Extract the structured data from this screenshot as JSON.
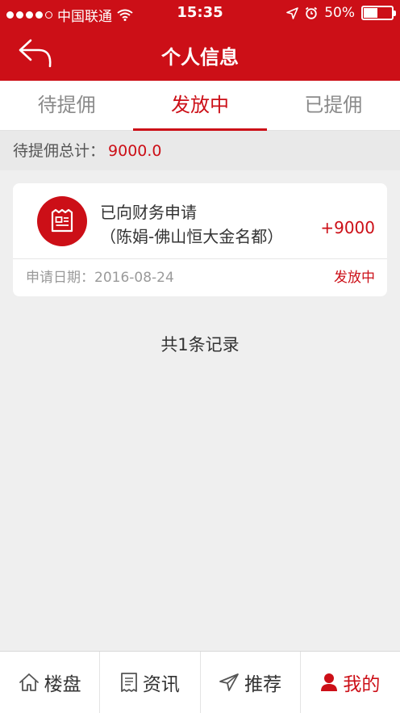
{
  "status_bar": {
    "carrier": "中国联通",
    "time": "15:35",
    "battery": "50%",
    "battery_level": 0.5
  },
  "nav": {
    "title": "个人信息",
    "back_icon": "back-arrow-icon"
  },
  "tabs": [
    {
      "label": "待提佣",
      "active": false
    },
    {
      "label": "发放中",
      "active": true
    },
    {
      "label": "已提佣",
      "active": false
    }
  ],
  "summary": {
    "label": "待提佣总计：",
    "value": "9000.0"
  },
  "records": [
    {
      "title": "已向财务申请",
      "subtitle": "（陈娟-佛山恒大金名都）",
      "amount": "+9000",
      "date_label": "申请日期：",
      "date": "2016-08-24",
      "status": "发放中",
      "icon": "document-icon"
    }
  ],
  "count_text": "共1条记录",
  "tabbar": [
    {
      "label": "楼盘",
      "icon": "home-icon",
      "active": false
    },
    {
      "label": "资讯",
      "icon": "news-icon",
      "active": false
    },
    {
      "label": "推荐",
      "icon": "send-icon",
      "active": false
    },
    {
      "label": "我的",
      "icon": "user-icon",
      "active": true
    }
  ],
  "colors": {
    "brand": "#cc0f17",
    "background": "#efefef"
  }
}
